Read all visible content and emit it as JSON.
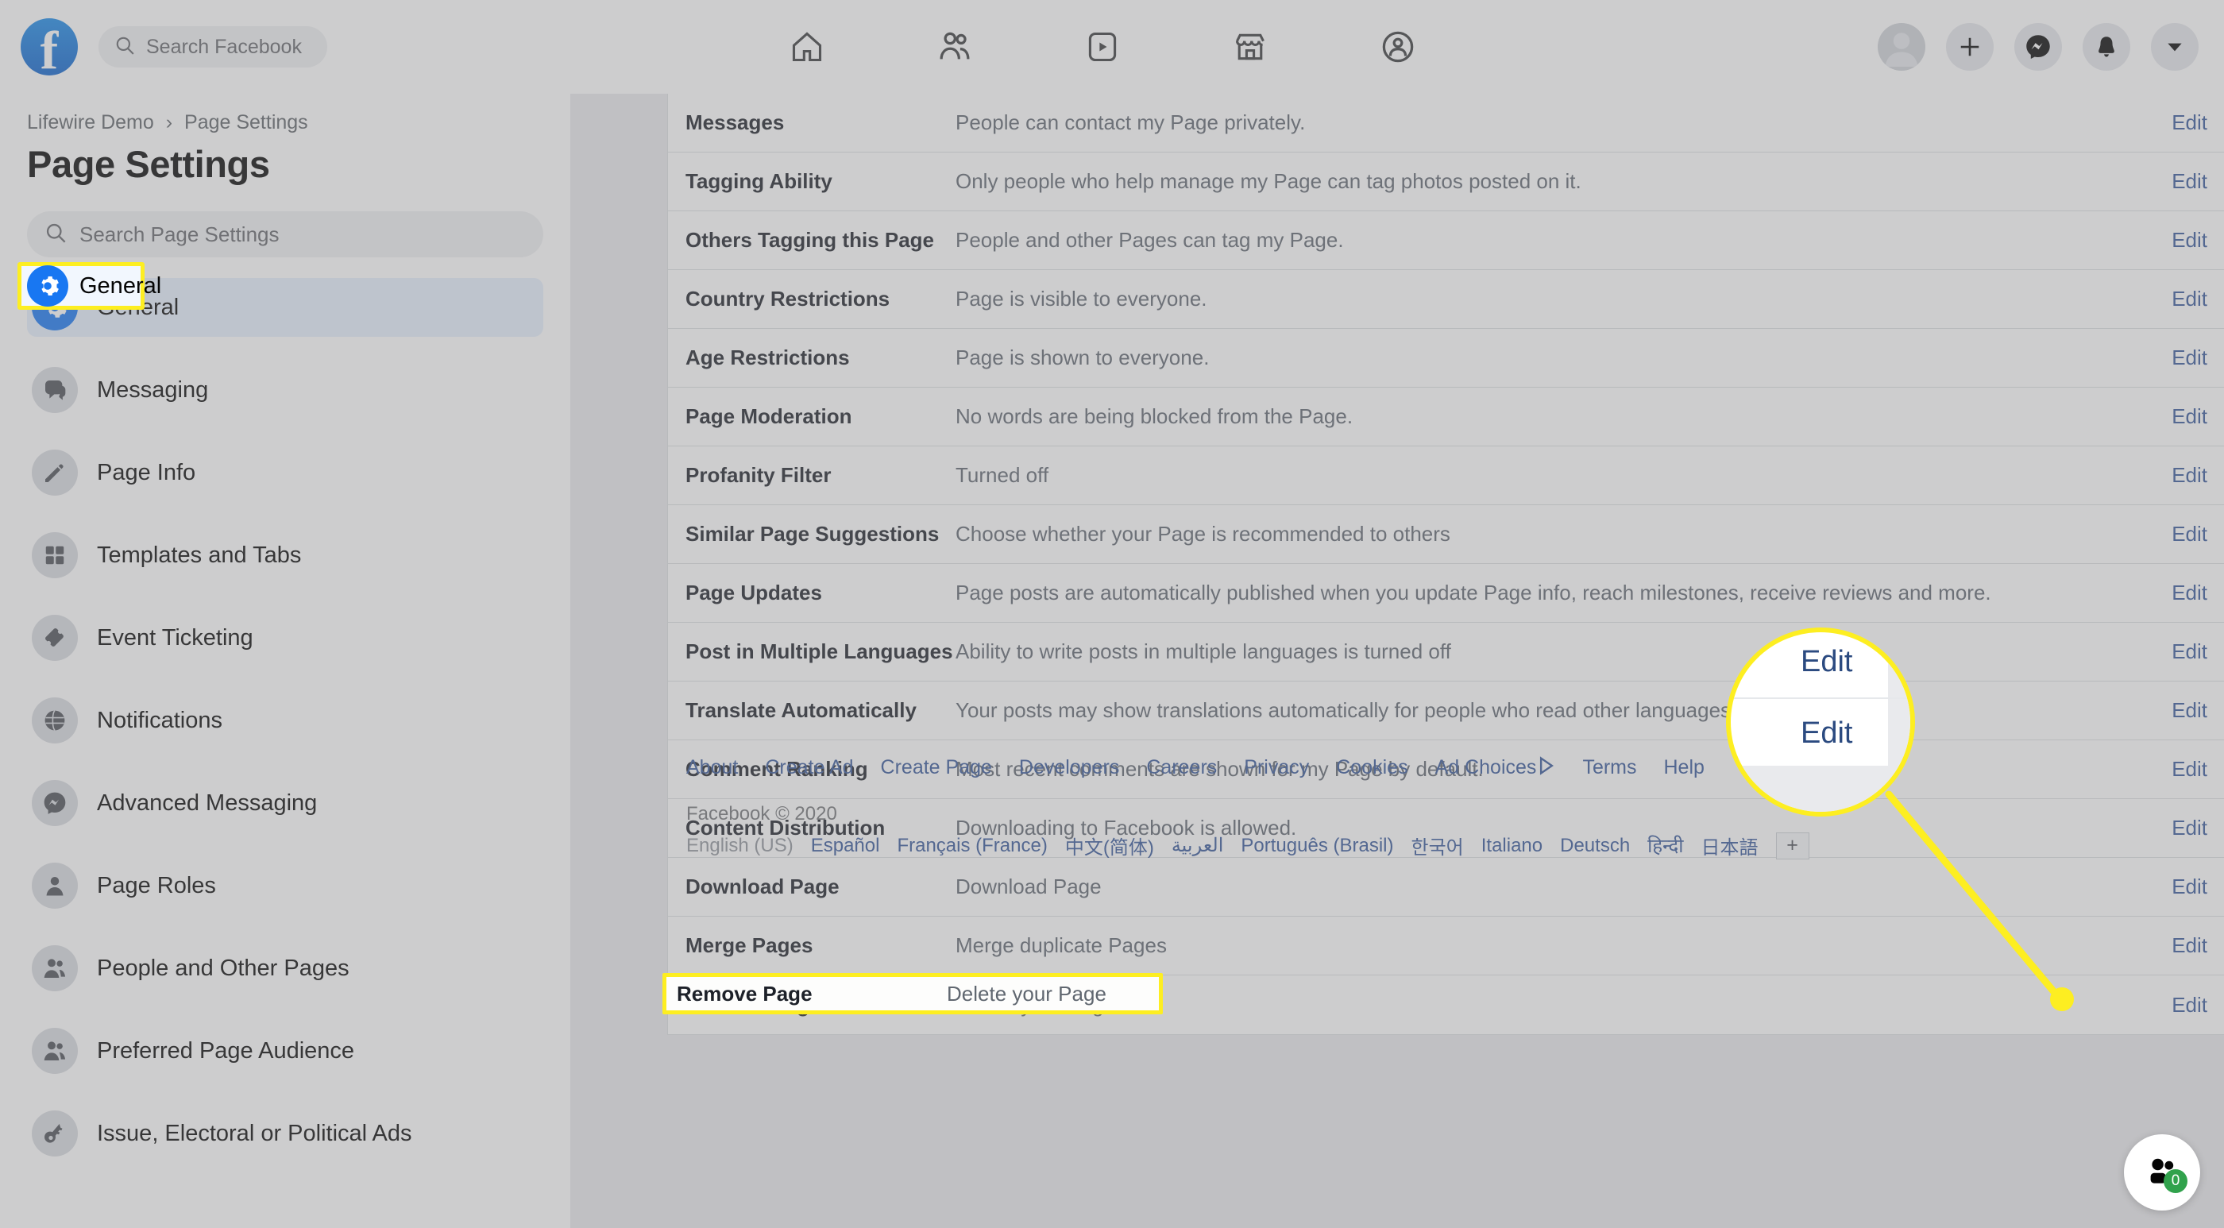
{
  "header": {
    "logo_icon": "facebook-logo",
    "logo_letter": "f",
    "search": {
      "placeholder": "Search Facebook",
      "icon": "search-icon",
      "value": ""
    },
    "nav_icons": [
      {
        "name": "home-icon",
        "label": "Home"
      },
      {
        "name": "friends-icon",
        "label": "Friends"
      },
      {
        "name": "watch-icon",
        "label": "Watch"
      },
      {
        "name": "marketplace-icon",
        "label": "Marketplace"
      },
      {
        "name": "groups-icon",
        "label": "Groups"
      }
    ],
    "right_icons": [
      {
        "name": "avatar",
        "label": "Profile"
      },
      {
        "name": "plus-icon",
        "label": "Create"
      },
      {
        "name": "messenger-icon",
        "label": "Messenger"
      },
      {
        "name": "bell-icon",
        "label": "Notifications"
      },
      {
        "name": "chevron-down-icon",
        "label": "Account"
      }
    ]
  },
  "sidebar": {
    "breadcrumb": {
      "parent": "Lifewire Demo",
      "separator": "›",
      "current": "Page Settings"
    },
    "title": "Page Settings",
    "search": {
      "placeholder": "Search Page Settings",
      "icon": "search-icon",
      "value": ""
    },
    "items": [
      {
        "label": "General",
        "icon": "gear-icon",
        "active": true
      },
      {
        "label": "Messaging",
        "icon": "chat-bubble-icon",
        "active": false
      },
      {
        "label": "Page Info",
        "icon": "pencil-icon",
        "active": false
      },
      {
        "label": "Templates and Tabs",
        "icon": "grid-icon",
        "active": false
      },
      {
        "label": "Event Ticketing",
        "icon": "ticket-icon",
        "active": false
      },
      {
        "label": "Notifications",
        "icon": "globe-icon",
        "active": false
      },
      {
        "label": "Advanced Messaging",
        "icon": "messenger-icon",
        "active": false
      },
      {
        "label": "Page Roles",
        "icon": "person-icon",
        "active": false
      },
      {
        "label": "People and Other Pages",
        "icon": "people-icon",
        "active": false
      },
      {
        "label": "Preferred Page Audience",
        "icon": "people-icon",
        "active": false
      },
      {
        "label": "Issue, Electoral or Political Ads",
        "icon": "key-icon",
        "active": false
      }
    ]
  },
  "settings_rows": [
    {
      "label": "Messages",
      "desc": "People can contact my Page privately.",
      "action": "Edit"
    },
    {
      "label": "Tagging Ability",
      "desc": "Only people who help manage my Page can tag photos posted on it.",
      "action": "Edit"
    },
    {
      "label": "Others Tagging this Page",
      "desc": "People and other Pages can tag my Page.",
      "action": "Edit"
    },
    {
      "label": "Country Restrictions",
      "desc": "Page is visible to everyone.",
      "action": "Edit"
    },
    {
      "label": "Age Restrictions",
      "desc": "Page is shown to everyone.",
      "action": "Edit"
    },
    {
      "label": "Page Moderation",
      "desc": "No words are being blocked from the Page.",
      "action": "Edit"
    },
    {
      "label": "Profanity Filter",
      "desc": "Turned off",
      "action": "Edit"
    },
    {
      "label": "Similar Page Suggestions",
      "desc": "Choose whether your Page is recommended to others",
      "action": "Edit"
    },
    {
      "label": "Page Updates",
      "desc": "Page posts are automatically published when you update Page info, reach milestones, receive reviews and more.",
      "action": "Edit"
    },
    {
      "label": "Post in Multiple Languages",
      "desc": "Ability to write posts in multiple languages is turned off",
      "action": "Edit"
    },
    {
      "label": "Translate Automatically",
      "desc": "Your posts may show translations automatically for people who read other languages.",
      "action": "Edit"
    },
    {
      "label": "Comment Ranking",
      "desc": "Most recent comments are shown for my Page by default.",
      "action": "Edit"
    },
    {
      "label": "Content Distribution",
      "desc": "Downloading to Facebook is allowed.",
      "action": "Edit"
    },
    {
      "label": "Download Page",
      "desc": "Download Page",
      "action": "Edit"
    },
    {
      "label": "Merge Pages",
      "desc": "Merge duplicate Pages",
      "action": "Edit"
    },
    {
      "label": "Remove Page",
      "desc": "Delete your Page",
      "action": "Edit"
    }
  ],
  "footer": {
    "links": [
      "About",
      "Create Ad",
      "Create Page",
      "Developers",
      "Careers",
      "Privacy",
      "Cookies",
      "Ad Choices",
      "Terms",
      "Help"
    ],
    "adchoices_icon": "ad-choices-triangle-icon",
    "copyright": "Facebook © 2020",
    "languages": [
      "English (US)",
      "Español",
      "Français (France)",
      "中文(简体)",
      "العربية",
      "Português (Brasil)",
      "한국어",
      "Italiano",
      "Deutsch",
      "हिन्दी",
      "日本語"
    ],
    "current_language": "English (US)",
    "more_languages_label": "+"
  },
  "annotations": {
    "general_highlight_label": "General",
    "general_highlight_icon": "gear-icon",
    "magnifier": {
      "edit_top": "Edit",
      "edit_bottom": "Edit",
      "border_color": "#fdee21"
    },
    "remove_page_highlight": {
      "label": "Remove Page",
      "desc": "Delete your Page",
      "border_color": "#fdee21"
    },
    "pointer_color": "#fdee21"
  },
  "chat_widget": {
    "icon": "people-icon",
    "badge_count": "0",
    "badge_color": "#31a24c"
  },
  "colors": {
    "brand": "#1877f2",
    "link": "#365899",
    "highlight": "#fdee21",
    "page_bg": "#e9eaed"
  }
}
